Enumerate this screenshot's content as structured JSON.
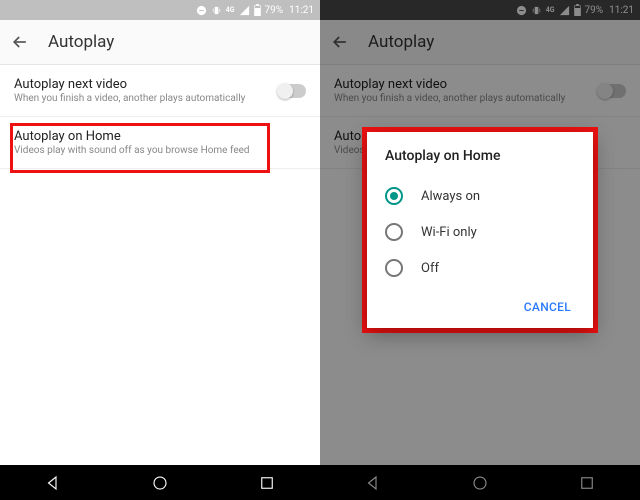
{
  "statusbar": {
    "battery_pct": "79%",
    "time": "11:21",
    "network": "4G LTE"
  },
  "toolbar": {
    "title": "Autoplay"
  },
  "settings": {
    "row0": {
      "title": "Autoplay next video",
      "sub": "When you finish a video, another plays automatically"
    },
    "row1": {
      "title": "Autoplay on Home",
      "sub": "Videos play with sound off as you browse Home feed"
    }
  },
  "dialog": {
    "title": "Autoplay on Home",
    "options": {
      "o0": "Always on",
      "o1": "Wi-Fi only",
      "o2": "Off"
    },
    "cancel": "CANCEL"
  }
}
